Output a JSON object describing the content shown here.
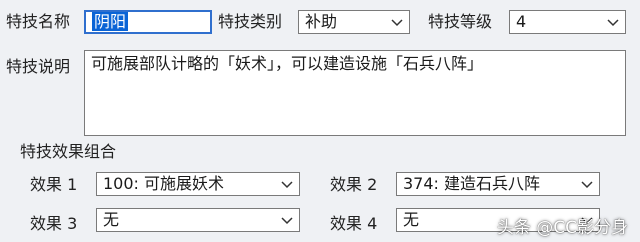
{
  "row1": {
    "name_label": "特技名称",
    "name_value": "阴阳",
    "type_label": "特技类别",
    "type_value": "补助",
    "level_label": "特技等级",
    "level_value": "4"
  },
  "desc": {
    "label": "特技说明",
    "text": "可施展部队计略的「妖术」，可以建造设施「石兵八阵」"
  },
  "effects": {
    "group_title": "特技效果组合",
    "items": [
      {
        "label": "效果 1",
        "value": "100: 可施展妖术"
      },
      {
        "label": "效果 2",
        "value": "374: 建造石兵八阵"
      },
      {
        "label": "效果 3",
        "value": "无"
      },
      {
        "label": "效果 4",
        "value": "无"
      }
    ]
  },
  "watermark": "头条 @CC影分身",
  "icons": {
    "dropdown": "chevron-down-icon"
  },
  "colors": {
    "selection": "#0a64d6",
    "focus_border": "#2f6fce"
  }
}
